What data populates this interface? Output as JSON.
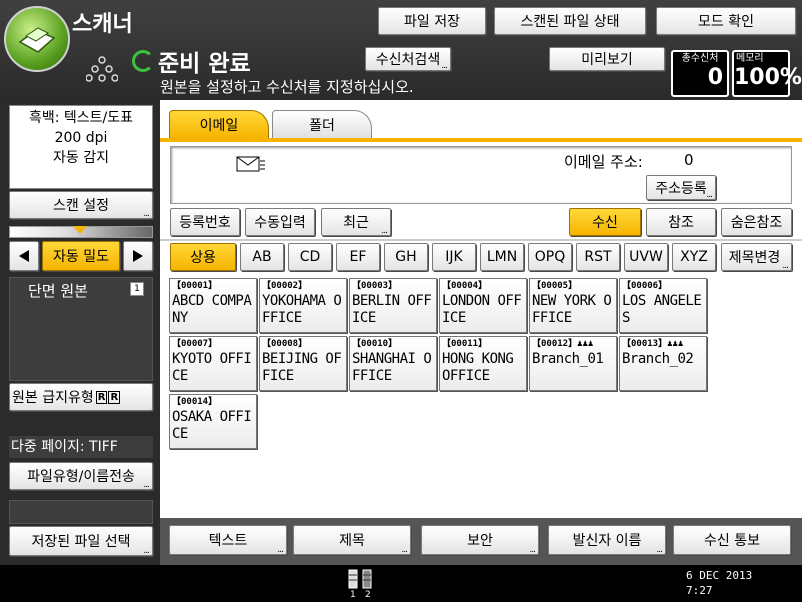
{
  "app": {
    "title": "스캐너"
  },
  "top_buttons": {
    "save_file": "파일 저장",
    "scanned_status": "스캔된 파일 상태",
    "check_mode": "모드 확인"
  },
  "status": {
    "title": "준비 완료",
    "message": "원본을 설정하고 수신처를 지정하십시오."
  },
  "dest_search": "수신처검색",
  "preview": "미리보기",
  "counters": {
    "total_label": "총수신처",
    "total_value": "0",
    "memory_label": "메모리",
    "memory_value": "100%"
  },
  "left": {
    "scan_mode_line1": "흑백: 텍스트/도표",
    "scan_mode_line2": "200 dpi",
    "scan_mode_line3": "자동 감지",
    "scan_settings": "스캔 설정",
    "density_label": "자동 밀도",
    "original_mode": "단면 원본",
    "original_feed": "원본 급지유형",
    "multipage": "다중 페이지: TIFF",
    "file_type": "파일유형/이름전송",
    "select_stored": "저장된 파일 선택"
  },
  "tabs": [
    {
      "label": "이메일"
    },
    {
      "label": "폴더"
    }
  ],
  "email": {
    "address_label": "이메일 주소:",
    "address_count": "0",
    "register": "주소등록"
  },
  "entry_buttons": {
    "reg_no": "등록번호",
    "manual": "수동입력",
    "recent": "최근"
  },
  "recipient_buttons": {
    "to": "수신",
    "cc": "참조",
    "bcc": "숨은참조"
  },
  "index_tabs": [
    "상용",
    "AB",
    "CD",
    "EF",
    "GH",
    "IJK",
    "LMN",
    "OPQ",
    "RST",
    "UVW",
    "XYZ",
    "제목변경"
  ],
  "destinations": [
    {
      "id": "【00001】",
      "name": "ABCD COMPANY"
    },
    {
      "id": "【00002】",
      "name": "YOKOHAMA OFFICE"
    },
    {
      "id": "【00003】",
      "name": "BERLIN OFFICE"
    },
    {
      "id": "【00004】",
      "name": "LONDON OFFICE"
    },
    {
      "id": "【00005】",
      "name": "NEW YORK OFFICE"
    },
    {
      "id": "【00006】",
      "name": "LOS ANGELES"
    },
    {
      "id": "【00007】",
      "name": "KYOTO OFFICE"
    },
    {
      "id": "【00008】",
      "name": "BEIJING OFFICE"
    },
    {
      "id": "【00010】",
      "name": "SHANGHAI OFFICE"
    },
    {
      "id": "【00011】",
      "name": "HONG KONG OFFICE"
    },
    {
      "id": "【00012】",
      "name": "Branch_01"
    },
    {
      "id": "【00013】",
      "name": "Branch_02"
    },
    {
      "id": "【00014】",
      "name": "OSAKA OFFICE"
    }
  ],
  "bottom_buttons": {
    "text": "텍스트",
    "subject": "제목",
    "security": "보안",
    "sender": "발신자 이름",
    "notify": "수신 통보"
  },
  "footer": {
    "date": "6 DEC  2013",
    "time": "7:27",
    "page1": "1",
    "page2": "2"
  },
  "colors": {
    "accent": "#f6b400",
    "ready_ring": "#3cc23c"
  }
}
